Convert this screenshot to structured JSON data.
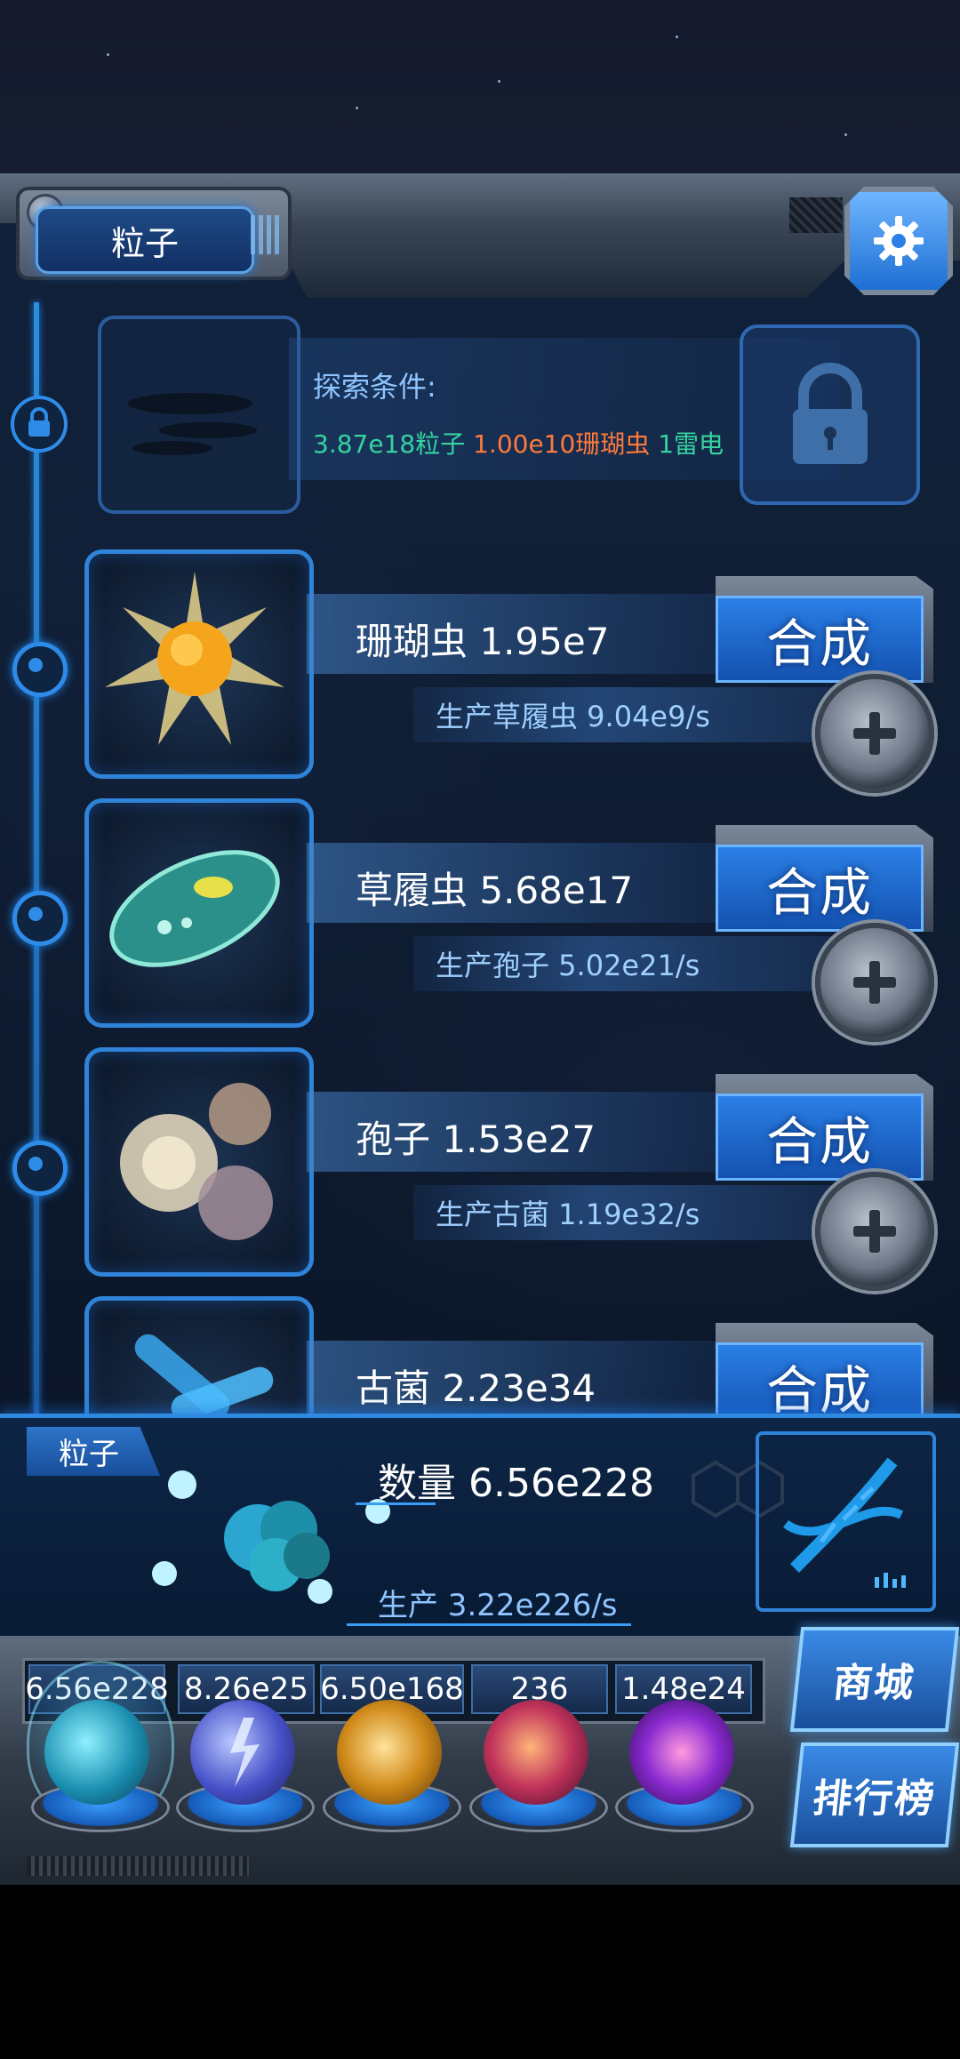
{
  "header": {
    "title": "粒子",
    "settings_icon": "gear-icon"
  },
  "locked_entry": {
    "title": "探索条件:",
    "requirements": [
      "3.87e18粒子",
      "1.00e10珊瑚虫",
      "1雷电"
    ],
    "colors": {
      "green": "#36d3a0",
      "orange": "#ff7a3c"
    },
    "icon": "padlock-icon"
  },
  "creatures": [
    {
      "name": "珊瑚虫 1.95e7",
      "produce": "生产草履虫 9.04e9/s",
      "synth_label": "合成"
    },
    {
      "name": "草履虫 5.68e17",
      "produce": "生产孢子 5.02e21/s",
      "synth_label": "合成"
    },
    {
      "name": "孢子 1.53e27",
      "produce": "生产古菌 1.19e32/s",
      "synth_label": "合成"
    },
    {
      "name": "古菌 2.23e34",
      "synth_label": "合成"
    }
  ],
  "info": {
    "tab": "粒子",
    "count": "数量 6.56e228",
    "rate": "生产 3.22e226/s"
  },
  "resources": [
    "6.56e228",
    "8.26e25",
    "6.50e168",
    "236",
    "1.48e24"
  ],
  "side_buttons": {
    "shop": "商城",
    "rank": "排行榜"
  },
  "colors": {
    "accent": "#2f83d8",
    "button_blue": "#1f6fd6"
  }
}
